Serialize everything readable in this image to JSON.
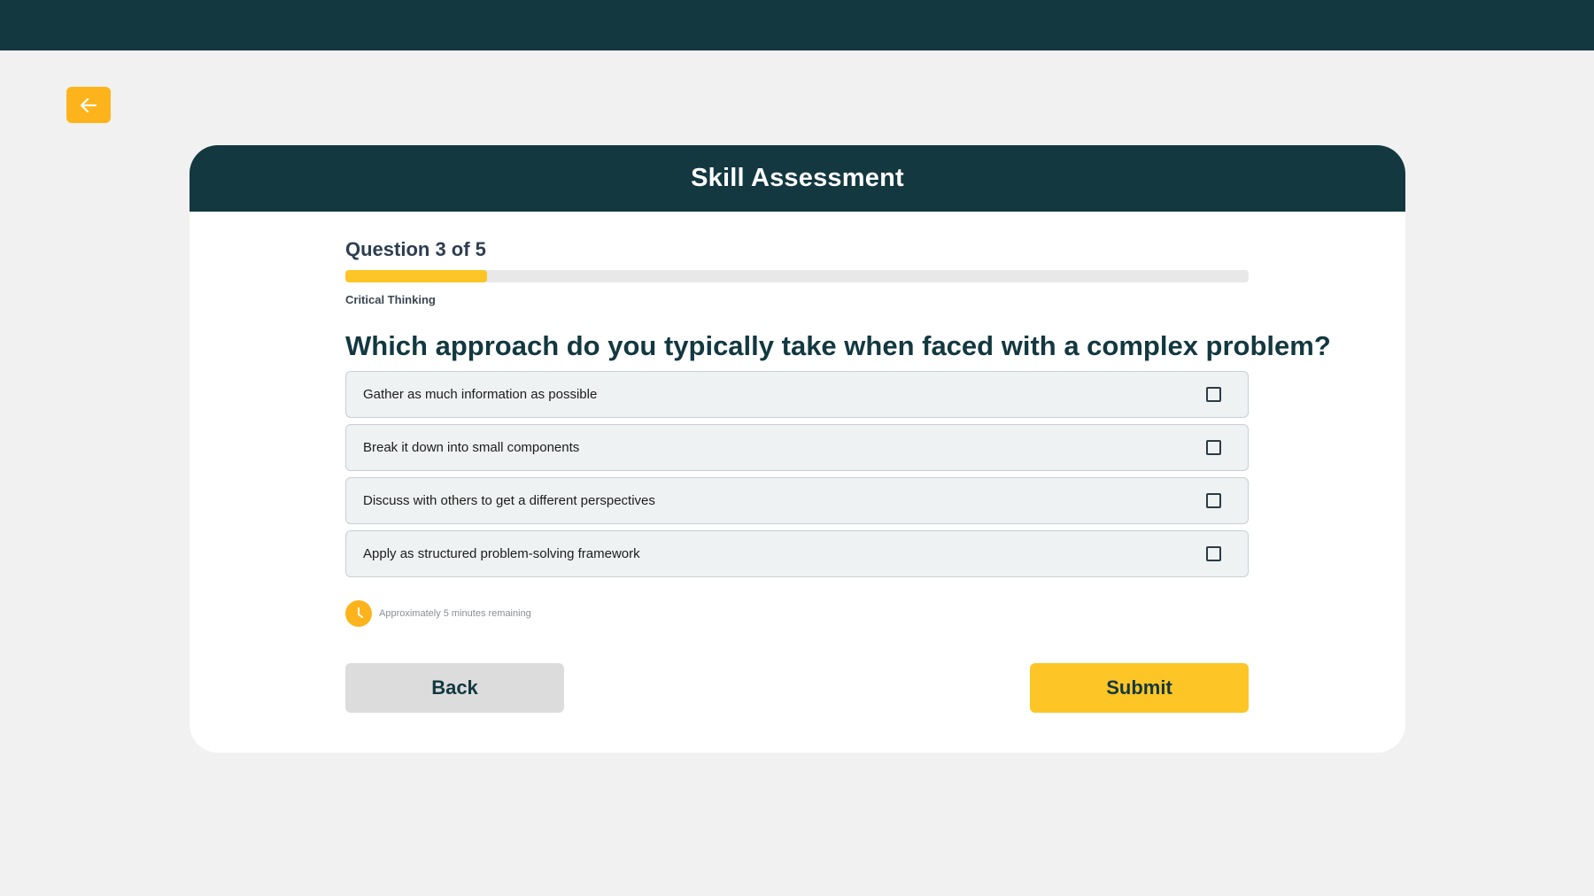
{
  "header": {
    "back_icon": "arrow-left-icon"
  },
  "card": {
    "title": "Skill Assessment"
  },
  "quiz": {
    "counter": "Question 3 of 5",
    "progress": 0.157,
    "category": "Critical Thinking",
    "question": "Which approach do you typically take when faced with a complex problem?",
    "options": [
      {
        "label": "Gather as much information as possible",
        "checked": false
      },
      {
        "label": "Break it down into small components",
        "checked": false
      },
      {
        "label": "Discuss with others to get a different perspectives",
        "checked": false
      },
      {
        "label": "Apply as structured problem-solving framework",
        "checked": false
      }
    ],
    "timer_icon": "clock-icon",
    "timer_text": "Approximately 5 minutes remaining"
  },
  "actions": {
    "back_label": "Back",
    "submit_label": "Submit"
  },
  "colors": {
    "primary_dark": "#133840",
    "accent_yellow": "#fdc526",
    "accent_orange": "#fdb41c"
  }
}
